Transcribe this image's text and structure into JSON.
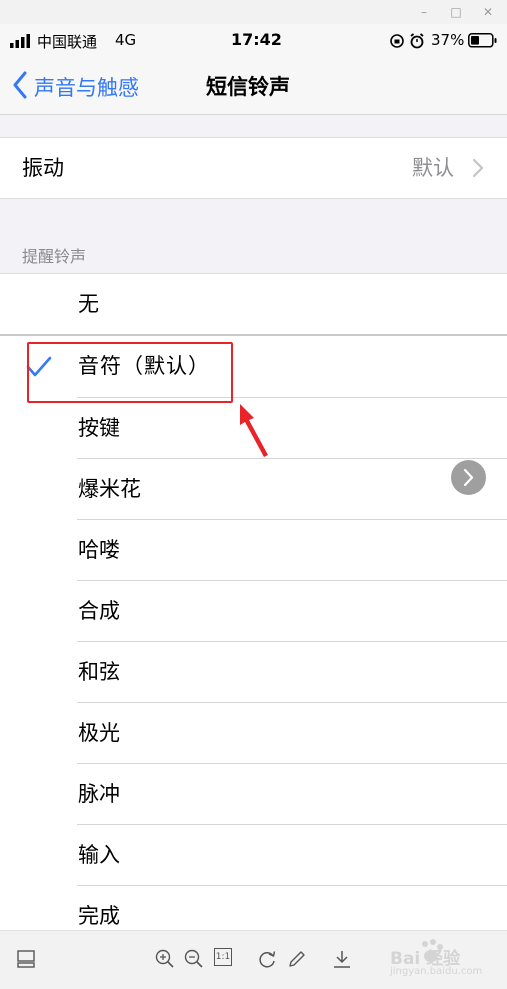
{
  "window": {
    "minimize": "–",
    "maximize": "□",
    "close": "✕"
  },
  "status": {
    "carrier": "中国联通",
    "network": "4G",
    "time": "17:42",
    "battery": "37%"
  },
  "nav": {
    "back_label": "声音与触感",
    "title": "短信铃声"
  },
  "vibration": {
    "label": "振动",
    "value": "默认"
  },
  "section_header": "提醒铃声",
  "tones": [
    {
      "label": "无",
      "selected": false
    },
    {
      "label": "音符（默认）",
      "selected": true
    },
    {
      "label": "按键",
      "selected": false
    },
    {
      "label": "爆米花",
      "selected": false
    },
    {
      "label": "哈喽",
      "selected": false
    },
    {
      "label": "合成",
      "selected": false
    },
    {
      "label": "和弦",
      "selected": false
    },
    {
      "label": "极光",
      "selected": false
    },
    {
      "label": "脉冲",
      "selected": false
    },
    {
      "label": "输入",
      "selected": false
    },
    {
      "label": "完成",
      "selected": false
    }
  ],
  "toolbar": {
    "zoom_ratio": "1:1"
  },
  "watermark": {
    "brand": "Bai 经验",
    "url": "jingyan.baidu.com"
  },
  "colors": {
    "accent": "#3478f6",
    "highlight": "#e8242a",
    "background": "#f2f2f7"
  }
}
